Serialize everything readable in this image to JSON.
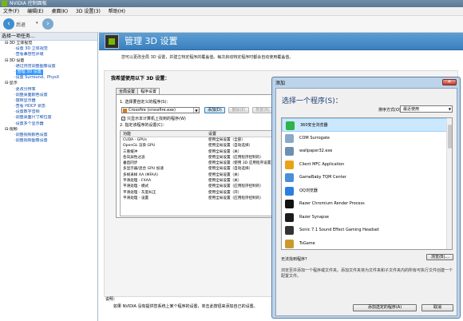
{
  "window": {
    "title": "NVIDIA 控制面板"
  },
  "menu": [
    "文件(F)",
    "编辑(E)",
    "桌面(K)",
    "3D 设置(3)",
    "帮助(H)"
  ],
  "toolbar": {
    "back_label": "后退",
    "dropdown": "▾"
  },
  "left_pane": {
    "header": "选择一项任务...",
    "tree": [
      {
        "text": "3D 立体视觉",
        "level": 1,
        "prefix": "⊟·"
      },
      {
        "text": "设置 3D 立体视觉",
        "level": 2
      },
      {
        "text": "查看兼容性评级",
        "level": 2
      },
      {
        "text": "3D 设置",
        "level": 1,
        "prefix": "⊟·"
      },
      {
        "text": "通过预览调整图像设置",
        "level": 2
      },
      {
        "text": "管理 3D 设置",
        "level": 2,
        "selected": true
      },
      {
        "text": "设置 Surround、PhysX",
        "level": 2
      },
      {
        "text": "显示",
        "level": 1,
        "prefix": "⊟·"
      },
      {
        "text": "更改分辨率",
        "level": 2
      },
      {
        "text": "调整桌面颜色设置",
        "level": 2
      },
      {
        "text": "旋转显示器",
        "level": 2
      },
      {
        "text": "查看 HDCP 状态",
        "level": 2
      },
      {
        "text": "设置数字音频",
        "level": 2
      },
      {
        "text": "调整桌面尺寸和位置",
        "level": 2
      },
      {
        "text": "设置多个显示器",
        "level": 2
      },
      {
        "text": "视频",
        "level": 1,
        "prefix": "⊟·"
      },
      {
        "text": "调整视频颜色设置",
        "level": 2
      },
      {
        "text": "调整视频图像设置",
        "level": 2
      }
    ]
  },
  "page": {
    "title": "管理 3D 设置",
    "description": "您可以更改全局 3D 设置，并建立特定程序的覆盖值。每次启动特定程序时都会自动使用覆盖值。",
    "settings_label": "我希望使用以下 3D 设置：",
    "tabs": [
      "全局设置",
      "程序设置"
    ],
    "active_tab": 1,
    "step1": "1. 选择要自定义的程序(S)：",
    "program_selected": "Crossfire (crossfire.exe)",
    "add_button": "添加(D)",
    "delete_button": "删除(E)",
    "restore_button": "恢复(R)",
    "show_only_checkbox": "只显示本计算机上找到的程序(W)",
    "step2": "2. 指定该程序的设置(C)：",
    "table_headers": [
      "功能",
      "设置"
    ],
    "table_rows": [
      [
        "CUDA - GPUs",
        "使用全局设置（全部）"
      ],
      [
        "OpenGL 渲染 GPU",
        "使用全局设置（自动选择）"
      ],
      [
        "三重缓冲",
        "使用全局设置（关）"
      ],
      [
        "各向异性过滤",
        "使用全局设置（应用程序控制的）"
      ],
      [
        "垂直同步",
        "使用全局设置（使用 3D 应用程序设置）"
      ],
      [
        "多显示器/混合 GPU 加速",
        "使用全局设置（自动选择）"
      ],
      [
        "多帧采样 AA (MFAA)",
        "使用全局设置（关）"
      ],
      [
        "平滑处理 - FXAA",
        "使用全局设置（关）"
      ],
      [
        "平滑处理 - 模式",
        "使用全局设置（应用程序控制的）"
      ],
      [
        "平滑处理 - 灰度纠正",
        "使用全局设置（开）"
      ],
      [
        "平滑处理 - 设置",
        "使用全局设置（应用程序控制的）"
      ]
    ],
    "explain_label": "说明：",
    "explain_text": "如果 NVIDIA 没有提供您系统上某个程序的设置，单击此按钮来添加自己的设置。"
  },
  "dialog": {
    "title": "添加",
    "close": "✕",
    "heading": "选择一个程序(S)：",
    "sort_label": "排序方式(O)：",
    "sort_value": "最近使用",
    "programs": [
      {
        "name": "360安全浏览器",
        "color": "#2fb34a",
        "selected": true
      },
      {
        "name": "COM Surrogate",
        "color": "#8aa9c8"
      },
      {
        "name": "wallpaper32.exe",
        "color": "#6f8fb0"
      },
      {
        "name": "Client MFC Application",
        "color": "#e8a417"
      },
      {
        "name": "GameBaby TQM Center",
        "color": "#4a8fd8"
      },
      {
        "name": "QQ浏览器",
        "color": "#2a7fe0"
      },
      {
        "name": "Razer Chromium Render Process",
        "color": "#111111"
      },
      {
        "name": "Razer Synapse",
        "color": "#1c1c1c"
      },
      {
        "name": "Sonic 7.1 Sound Effect Gaming Headset",
        "color": "#333333"
      },
      {
        "name": "TsGame",
        "color": "#c99a2e"
      }
    ],
    "not_found": "无法找到程序？",
    "browse_button": "浏览(B)...",
    "help_text": "浏览至并添加一个程序或文件夹。添加文件夹将为文件夹和子文件夹内的所有可执行文件创建一个配置文件。",
    "add_selected_button": "添加选定的程序(A)",
    "cancel_button": "取消"
  }
}
